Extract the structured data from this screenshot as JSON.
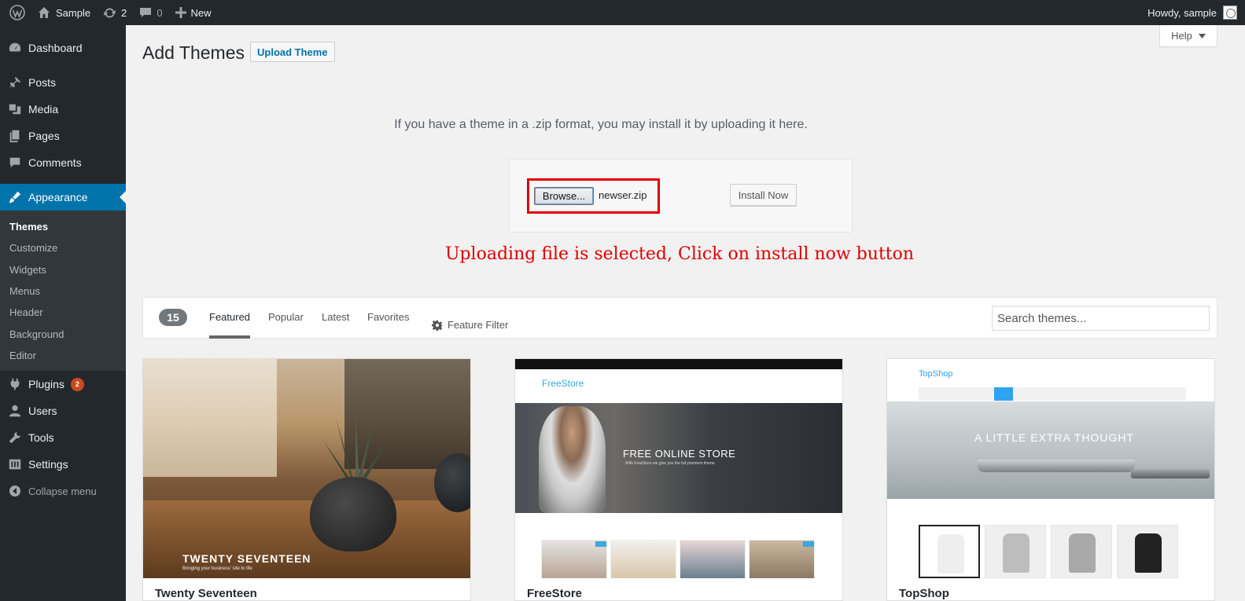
{
  "adminbar": {
    "site_name": "Sample",
    "updates_count": "2",
    "comments_count": "0",
    "new_label": "New",
    "howdy": "Howdy, sample"
  },
  "sidebar": {
    "items": [
      {
        "label": "Dashboard",
        "icon": "dashboard-icon"
      },
      {
        "label": "Posts",
        "icon": "pin-icon"
      },
      {
        "label": "Media",
        "icon": "media-icon"
      },
      {
        "label": "Pages",
        "icon": "pages-icon"
      },
      {
        "label": "Comments",
        "icon": "comment-icon"
      },
      {
        "label": "Appearance",
        "icon": "brush-icon"
      }
    ],
    "submenu": [
      "Themes",
      "Customize",
      "Widgets",
      "Menus",
      "Header",
      "Background",
      "Editor"
    ],
    "after": [
      {
        "label": "Plugins",
        "icon": "plugin-icon",
        "badge": "2"
      },
      {
        "label": "Users",
        "icon": "users-icon"
      },
      {
        "label": "Tools",
        "icon": "tools-icon"
      },
      {
        "label": "Settings",
        "icon": "settings-icon"
      }
    ],
    "collapse": "Collapse menu"
  },
  "page": {
    "title": "Add Themes",
    "upload_button": "Upload Theme",
    "help": "Help",
    "upload_text": "If you have a theme in a .zip format, you may install it by uploading it here.",
    "browse": "Browse...",
    "filename": "newser.zip",
    "install_now": "Install Now",
    "annotation": "Uploading file is selected, Click on install now button"
  },
  "filter": {
    "count": "15",
    "tabs": [
      "Featured",
      "Popular",
      "Latest",
      "Favorites"
    ],
    "feature_filter": "Feature Filter",
    "search_placeholder": "Search themes..."
  },
  "themes": [
    {
      "name": "Twenty Seventeen",
      "shot_title": "TWENTY SEVENTEEN",
      "shot_sub": "Bringing your business' site to life"
    },
    {
      "name": "FreeStore",
      "shot_logo": "FreeStore",
      "shot_title": "FREE ONLINE STORE",
      "shot_sub": "With FreeStore we give you the full premium theme"
    },
    {
      "name": "TopShop",
      "shot_logo": "TopShop",
      "shot_title": "A LITTLE EXTRA THOUGHT"
    }
  ],
  "colors": {
    "adminbar_bg": "#23282d",
    "accent": "#0073aa",
    "annotation_red": "#e00000",
    "badge": "#ca4a1f"
  }
}
